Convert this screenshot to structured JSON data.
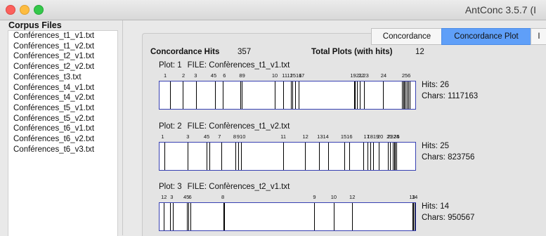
{
  "window": {
    "title": "AntConc 3.5.7 (I"
  },
  "corpus": {
    "heading": "Corpus Files",
    "files": [
      "Conférences_t1_v1.txt",
      "Conférences_t1_v2.txt",
      "Conférences_t2_v1.txt",
      "Conférences_t2_v2.txt",
      "Conférences_t3.txt",
      "Conférences_t4_v1.txt",
      "Conférences_t4_v2.txt",
      "Conférences_t5_v1.txt",
      "Conférences_t5_v2.txt",
      "Conférences_t6_v1.txt",
      "Conférences_t6_v2.txt",
      "Conférences_t6_v3.txt"
    ]
  },
  "tabs": {
    "concordance": "Concordance",
    "plot": "Concordance Plot",
    "partial": "I"
  },
  "stats": {
    "hits_label": "Concordance Hits",
    "hits_value": "357",
    "plots_label": "Total Plots (with hits)",
    "plots_value": "12"
  },
  "plots": [
    {
      "plot_label": "Plot: 1",
      "file_label": "FILE: Confèrences_t1_v1.txt",
      "hits": "Hits: 26",
      "chars": "Chars: 1117163",
      "hit_positions": [
        0.042,
        0.092,
        0.142,
        0.216,
        0.248,
        0.316,
        0.322,
        0.451,
        0.484,
        0.514,
        0.52,
        0.531,
        0.544,
        0.76,
        0.765,
        0.772,
        0.782,
        0.8,
        0.874,
        0.947,
        0.952,
        0.957,
        0.962,
        0.968,
        0.972,
        0.978
      ],
      "labels": [
        {
          "t": "1",
          "p": 0.025
        },
        {
          "t": "2",
          "p": 0.096
        },
        {
          "t": "3",
          "p": 0.143
        },
        {
          "t": "45",
          "p": 0.213
        },
        {
          "t": "6",
          "p": 0.255
        },
        {
          "t": "89",
          "p": 0.324
        },
        {
          "t": "10",
          "p": 0.451
        },
        {
          "t": "1112",
          "p": 0.5
        },
        {
          "t": "1516",
          "p": 0.533
        },
        {
          "t": "17",
          "p": 0.555
        },
        {
          "t": "1921",
          "p": 0.767
        },
        {
          "t": "22",
          "p": 0.787
        },
        {
          "t": "23",
          "p": 0.805
        },
        {
          "t": "24",
          "p": 0.874
        },
        {
          "t": "256",
          "p": 0.962
        }
      ]
    },
    {
      "plot_label": "Plot: 2",
      "file_label": "FILE: Confèrences_t1_v2.txt",
      "hits": "Hits: 25",
      "chars": "Chars: 823756",
      "hit_positions": [
        0.02,
        0.11,
        0.184,
        0.194,
        0.241,
        0.298,
        0.308,
        0.318,
        0.484,
        0.57,
        0.624,
        0.658,
        0.722,
        0.742,
        0.798,
        0.814,
        0.824,
        0.834,
        0.856,
        0.892,
        0.902,
        0.913,
        0.917,
        0.921,
        0.925
      ],
      "labels": [
        {
          "t": "1",
          "p": 0.015
        },
        {
          "t": "3",
          "p": 0.113
        },
        {
          "t": "45",
          "p": 0.186
        },
        {
          "t": "7",
          "p": 0.236
        },
        {
          "t": "8",
          "p": 0.295
        },
        {
          "t": "910",
          "p": 0.32
        },
        {
          "t": "11",
          "p": 0.484
        },
        {
          "t": "12",
          "p": 0.57
        },
        {
          "t": "1314",
          "p": 0.638
        },
        {
          "t": "1516",
          "p": 0.73
        },
        {
          "t": "17",
          "p": 0.808
        },
        {
          "t": "1819",
          "p": 0.833
        },
        {
          "t": "20",
          "p": 0.861
        },
        {
          "t": "21",
          "p": 0.897
        },
        {
          "t": "2324",
          "p": 0.912
        },
        {
          "t": "25",
          "p": 0.925
        }
      ]
    },
    {
      "plot_label": "Plot: 3",
      "file_label": "FILE: Confèrences_t2_v1.txt",
      "hits": "Hits: 14",
      "chars": "Chars: 950567",
      "hit_positions": [
        0.016,
        0.04,
        0.053,
        0.107,
        0.114,
        0.122,
        0.249,
        0.252,
        0.605,
        0.68,
        0.752,
        0.99,
        0.993,
        0.996
      ],
      "labels": [
        {
          "t": "12",
          "p": 0.02
        },
        {
          "t": "3",
          "p": 0.05
        },
        {
          "t": "45",
          "p": 0.107
        },
        {
          "t": "6",
          "p": 0.122
        },
        {
          "t": "8",
          "p": 0.249
        },
        {
          "t": "9",
          "p": 0.605
        },
        {
          "t": "10",
          "p": 0.68
        },
        {
          "t": "12",
          "p": 0.752
        },
        {
          "t": "13",
          "p": 0.985
        },
        {
          "t": "14",
          "p": 0.995
        }
      ]
    }
  ]
}
